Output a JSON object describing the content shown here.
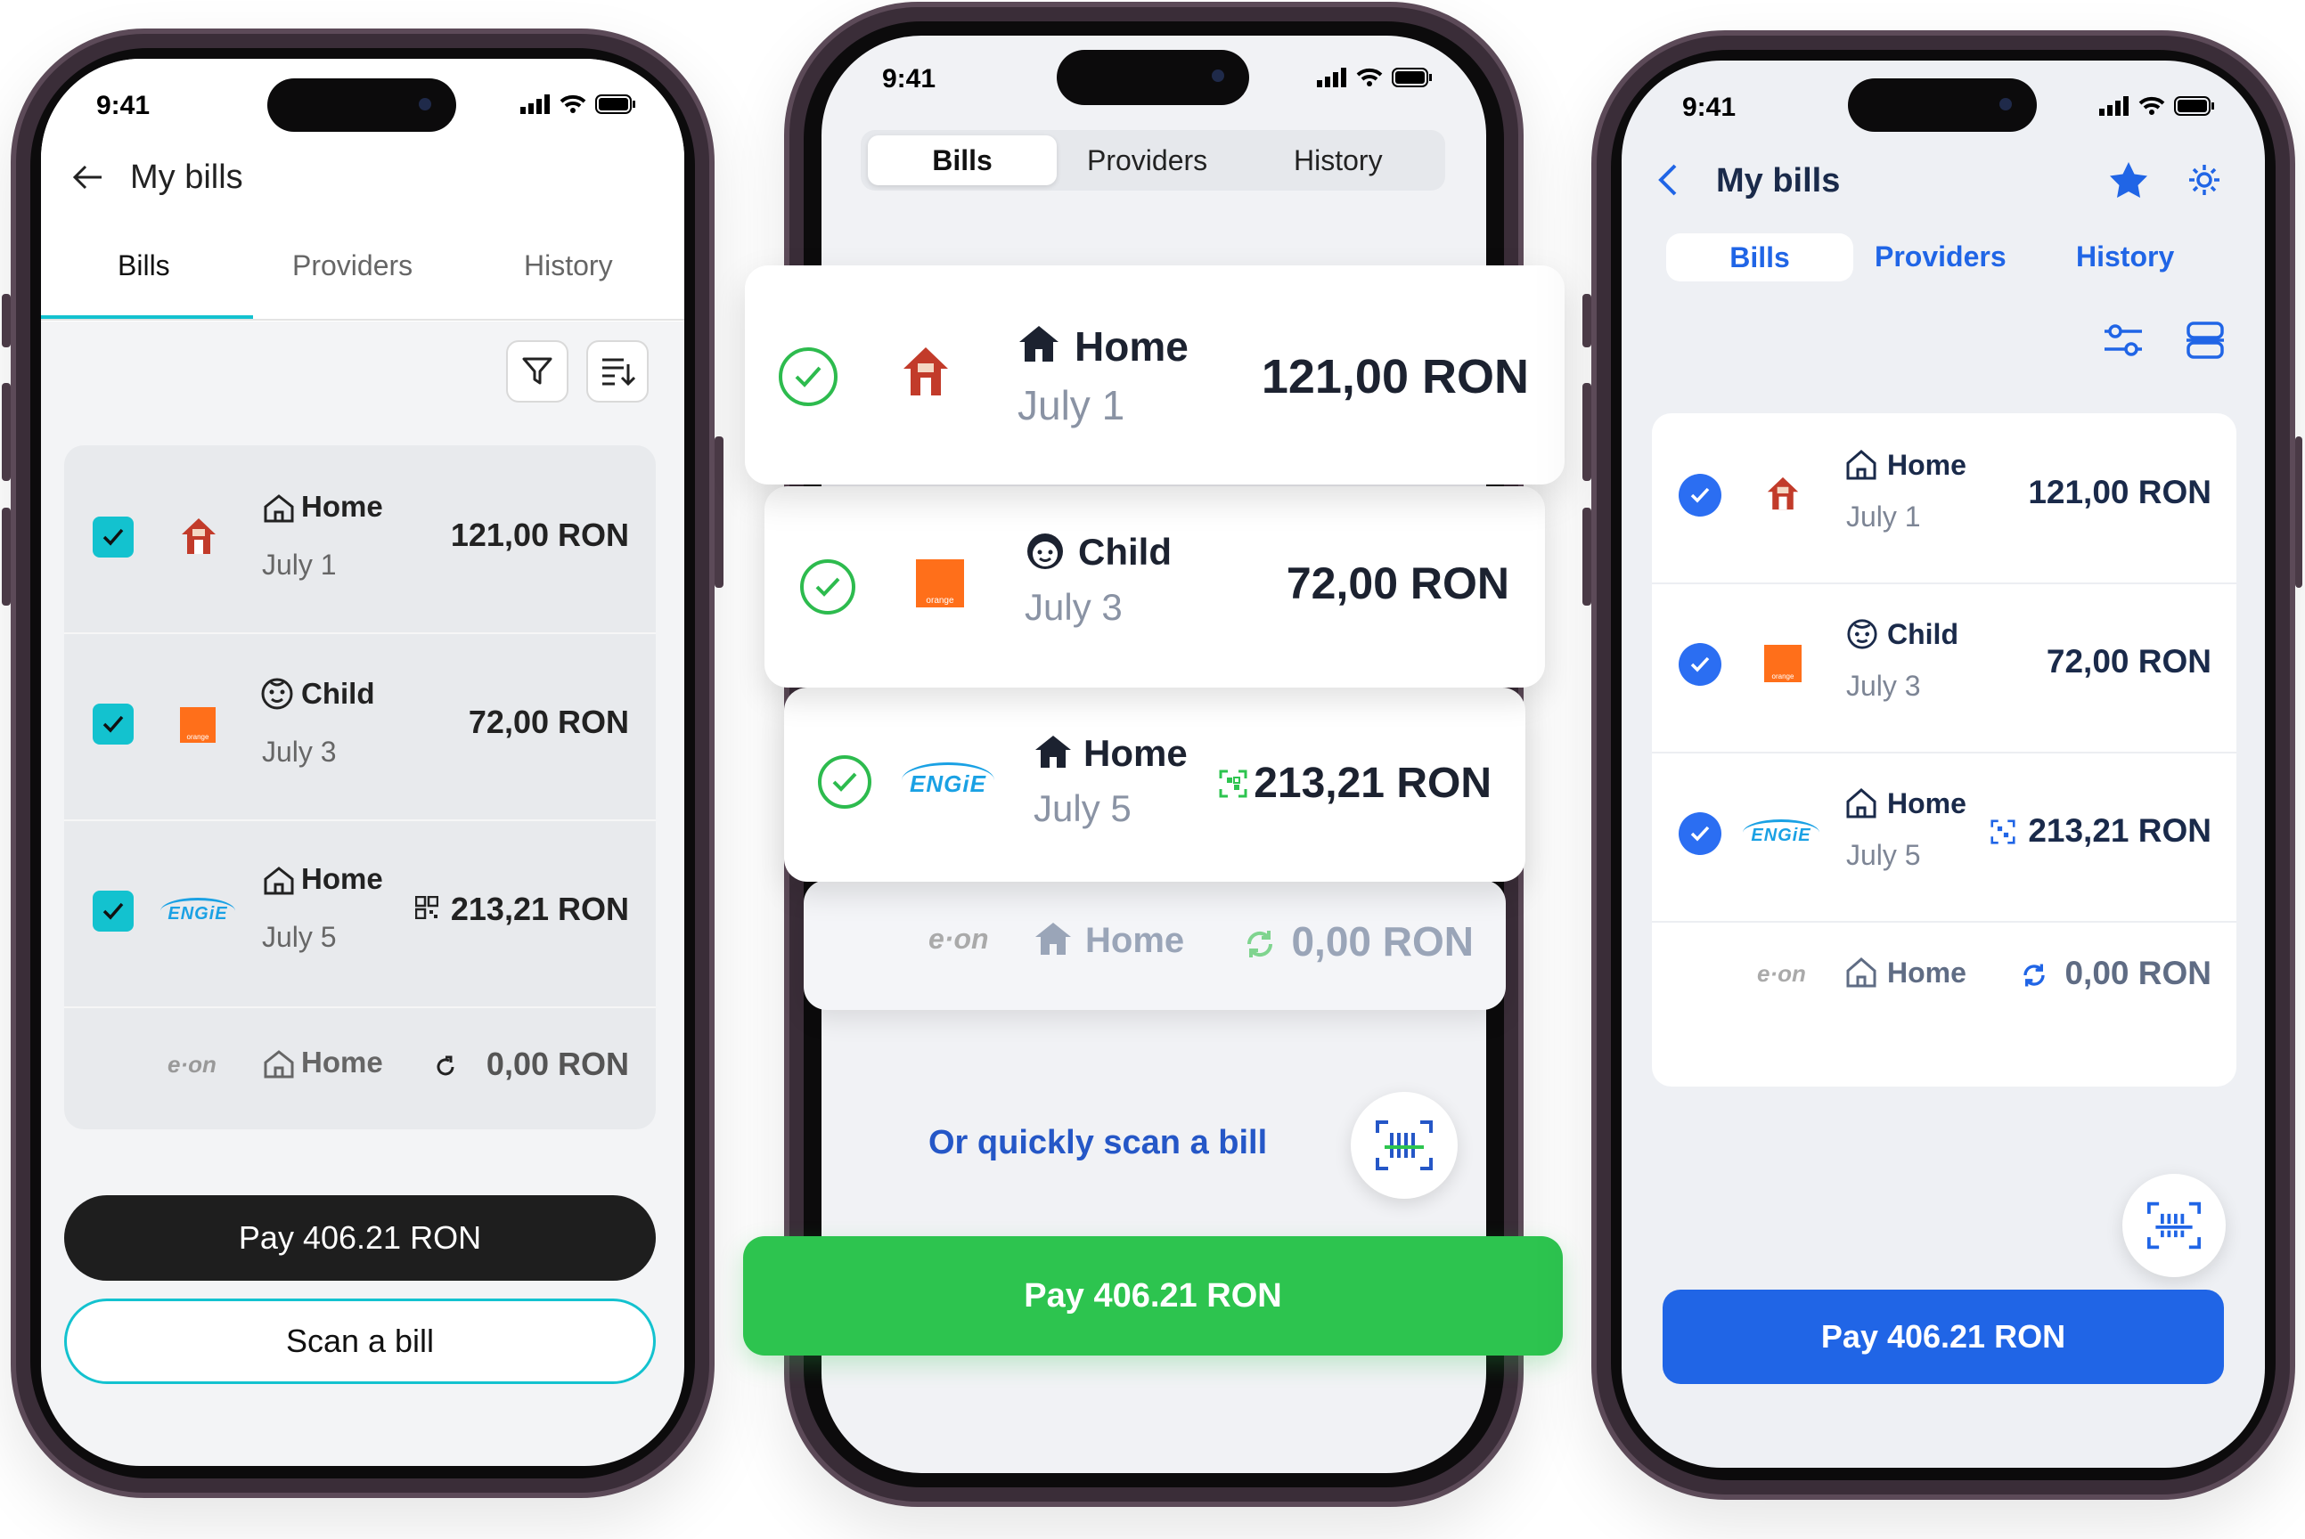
{
  "status": {
    "time": "9:41"
  },
  "phone1": {
    "header_title": "My bills",
    "tabs": [
      "Bills",
      "Providers",
      "History"
    ],
    "bills": [
      {
        "label": "Home",
        "date": "July 1",
        "amount": "121,00 RON",
        "icon": "home-outline-icon",
        "logo": "house-logo"
      },
      {
        "label": "Child",
        "date": "July 3",
        "amount": "72,00 RON",
        "icon": "child-face-icon",
        "logo": "orange-logo",
        "logo_text": "orange"
      },
      {
        "label": "Home",
        "date": "July 5",
        "amount": "213,21 RON",
        "icon": "home-outline-icon",
        "logo": "engie-logo",
        "logo_text": "ENGiE"
      },
      {
        "label": "Home",
        "amount": "0,00 RON",
        "icon": "home-outline-icon",
        "logo": "eon-logo",
        "logo_text": "e·on"
      }
    ],
    "pay_button": "Pay 406.21 RON",
    "scan_button": "Scan a bill",
    "accent": "#13c2cf"
  },
  "phone2": {
    "tabs": [
      "Bills",
      "Providers",
      "History"
    ],
    "bills": [
      {
        "label": "Home",
        "date": "July 1",
        "amount": "121,00 RON"
      },
      {
        "label": "Child",
        "date": "July 3",
        "amount": "72,00 RON"
      },
      {
        "label": "Home",
        "date": "July 5",
        "amount": "213,21 RON"
      },
      {
        "label": "Home",
        "amount": "0,00 RON"
      }
    ],
    "scan_prompt": "Or quickly scan a bill",
    "pay_button": "Pay 406.21 RON",
    "accent": "#2dc44f"
  },
  "phone3": {
    "header_title": "My bills",
    "tabs": [
      "Bills",
      "Providers",
      "History"
    ],
    "bills": [
      {
        "label": "Home",
        "date": "July 1",
        "amount": "121,00 RON"
      },
      {
        "label": "Child",
        "date": "July 3",
        "amount": "72,00 RON"
      },
      {
        "label": "Home",
        "date": "July 5",
        "amount": "213,21 RON"
      },
      {
        "label": "Home",
        "amount": "0,00 RON"
      }
    ],
    "pay_button": "Pay 406.21 RON",
    "accent": "#2065e6"
  }
}
